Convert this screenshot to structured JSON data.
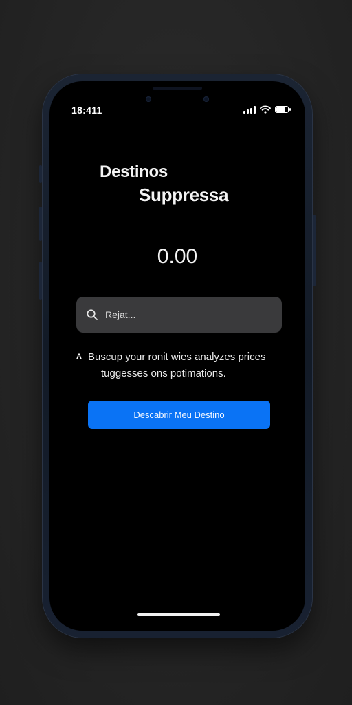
{
  "status_bar": {
    "time": "18:411",
    "icons": [
      "cellular-signal-icon",
      "wifi-icon",
      "battery-icon"
    ],
    "battery_level": 0.85
  },
  "header": {
    "title_line1": "Destinos",
    "title_line2": "Suppressa"
  },
  "amount": "0.00",
  "search": {
    "icon": "search-icon",
    "placeholder": "Rejat..."
  },
  "info": {
    "marker": "A",
    "line1": "Buscup your ronit wies analyzes prices",
    "line2": "tuggesses ons potimations."
  },
  "cta": {
    "label": "Descabrir Meu Destino"
  },
  "colors": {
    "background": "#262626",
    "screen": "#000000",
    "search_field": "#3a3a3c",
    "accent": "#0a73f5",
    "text": "#f4f4f4"
  }
}
